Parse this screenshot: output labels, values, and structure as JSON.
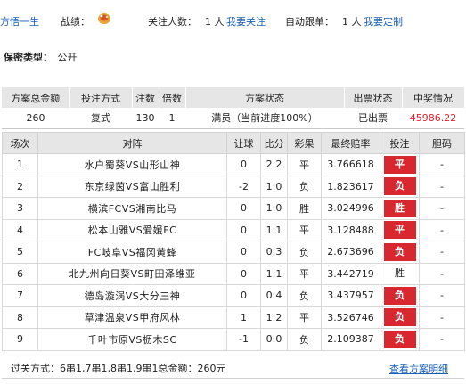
{
  "header": {
    "username": "方悟一生",
    "record_label": "战绩：",
    "followers_label": "关注人数：",
    "followers_count": "1 人",
    "follow_link": "我要关注",
    "auto_follow_label": "自动跟单：",
    "auto_follow_count": "1 人",
    "custom_link": "我要定制"
  },
  "privacy": {
    "label": "保密类型：",
    "value": "公开"
  },
  "summary": {
    "headers": [
      "方案总金额",
      "投注方式",
      "注数",
      "倍数",
      "方案状态",
      "出票状态",
      "中奖情况"
    ],
    "row": {
      "total_amount": "260",
      "bet_type": "复式",
      "count": "130",
      "multiple": "1",
      "plan_status": "满员（当前进度100%）",
      "ticket_status": "已出票",
      "prize": "45986.22"
    }
  },
  "matches": {
    "headers": [
      "场次",
      "对阵",
      "让球",
      "比分",
      "彩果",
      "最终赔率",
      "投注",
      "胆码"
    ],
    "rows": [
      {
        "no": "1",
        "teams": "水户蜀葵VS山形山神",
        "handicap": "0",
        "score": "2:2",
        "result": "平",
        "odds": "3.766618",
        "pick": "平",
        "banker": "-",
        "highlight": true
      },
      {
        "no": "2",
        "teams": "东京绿茵VS富山胜利",
        "handicap": "-2",
        "score": "1:0",
        "result": "负",
        "odds": "1.823617",
        "pick": "负",
        "banker": "-",
        "highlight": true
      },
      {
        "no": "3",
        "teams": "横滨FCVS湘南比马",
        "handicap": "0",
        "score": "1:0",
        "result": "胜",
        "odds": "3.024996",
        "pick": "胜",
        "banker": "-",
        "highlight": true
      },
      {
        "no": "4",
        "teams": "松本山雅VS爱媛FC",
        "handicap": "0",
        "score": "1:1",
        "result": "平",
        "odds": "3.128488",
        "pick": "平",
        "banker": "-",
        "highlight": true
      },
      {
        "no": "5",
        "teams": "FC岐阜VS福冈黄蜂",
        "handicap": "0",
        "score": "0:3",
        "result": "负",
        "odds": "2.673696",
        "pick": "负",
        "banker": "-",
        "highlight": true
      },
      {
        "no": "6",
        "teams": "北九州向日葵VS町田泽维亚",
        "handicap": "0",
        "score": "1:1",
        "result": "平",
        "odds": "3.442719",
        "pick": "胜",
        "banker": "-",
        "highlight": false
      },
      {
        "no": "7",
        "teams": "德岛漩涡VS大分三神",
        "handicap": "0",
        "score": "0:4",
        "result": "负",
        "odds": "3.437957",
        "pick": "负",
        "banker": "-",
        "highlight": true
      },
      {
        "no": "8",
        "teams": "草津温泉VS甲府风林",
        "handicap": "1",
        "score": "1:2",
        "result": "平",
        "odds": "3.526746",
        "pick": "负",
        "banker": "-",
        "highlight": true
      },
      {
        "no": "9",
        "teams": "千叶市原VS枥木SC",
        "handicap": "-1",
        "score": "0:0",
        "result": "负",
        "odds": "2.109387",
        "pick": "负",
        "banker": "-",
        "highlight": true
      }
    ]
  },
  "footer": {
    "pass_text": "过关方式：6串1,7串1,8串1,9串1总金额：260元",
    "detail_link": "查看方案明细"
  },
  "icons": {
    "record": "trophy-icon"
  },
  "colors": {
    "pick_red": "#d8272e",
    "prize_red": "#e0202a",
    "link_blue": "#1a5fb4",
    "header_gray": "#e6e6e6"
  }
}
